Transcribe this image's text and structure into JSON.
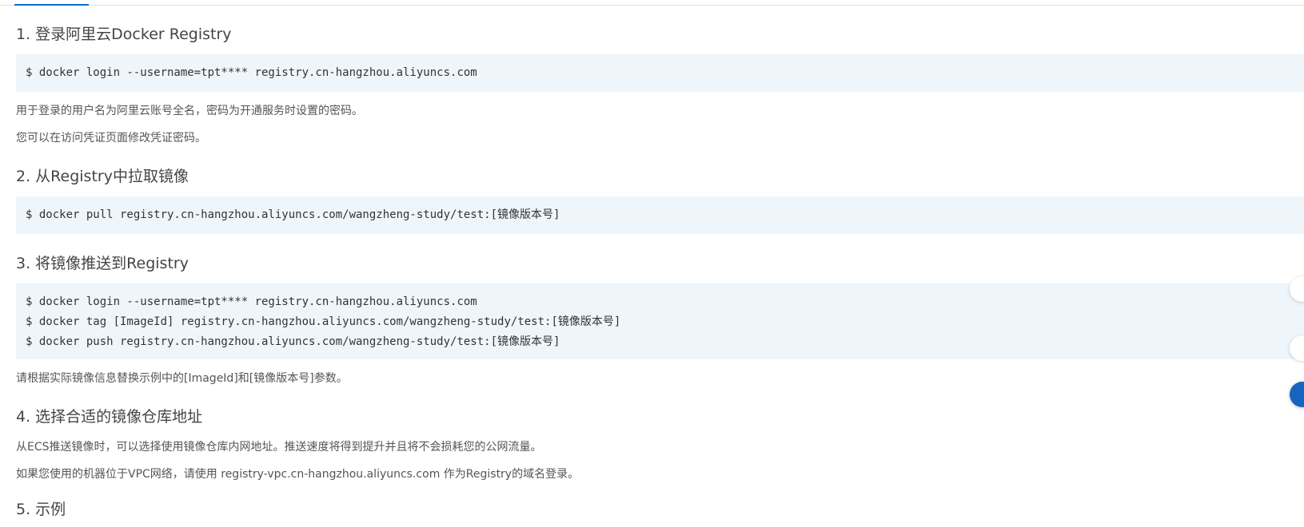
{
  "steps": [
    {
      "heading": "1. 登录阿里云Docker Registry",
      "code": [
        "$ docker login --username=tpt**** registry.cn-hangzhou.aliyuncs.com"
      ],
      "notes": [
        "用于登录的用户名为阿里云账号全名，密码为开通服务时设置的密码。",
        "您可以在访问凭证页面修改凭证密码。"
      ]
    },
    {
      "heading": "2. 从Registry中拉取镜像",
      "code": [
        "$ docker pull registry.cn-hangzhou.aliyuncs.com/wangzheng-study/test:[镜像版本号]"
      ],
      "notes": []
    },
    {
      "heading": "3. 将镜像推送到Registry",
      "code": [
        "$ docker login --username=tpt**** registry.cn-hangzhou.aliyuncs.com",
        "$ docker tag [ImageId] registry.cn-hangzhou.aliyuncs.com/wangzheng-study/test:[镜像版本号]",
        "$ docker push registry.cn-hangzhou.aliyuncs.com/wangzheng-study/test:[镜像版本号]"
      ],
      "notes": [
        "请根据实际镜像信息替换示例中的[ImageId]和[镜像版本号]参数。"
      ]
    },
    {
      "heading": "4. 选择合适的镜像仓库地址",
      "code": [],
      "notes": [
        "从ECS推送镜像时，可以选择使用镜像仓库内网地址。推送速度将得到提升并且将不会损耗您的公网流量。",
        "如果您使用的机器位于VPC网络，请使用 registry-vpc.cn-hangzhou.aliyuncs.com 作为Registry的域名登录。"
      ]
    },
    {
      "heading": "5. 示例"
    }
  ],
  "colors": {
    "accent": "#0070cc",
    "code_background": "#eef6fc",
    "float_primary": "#1565c0"
  }
}
